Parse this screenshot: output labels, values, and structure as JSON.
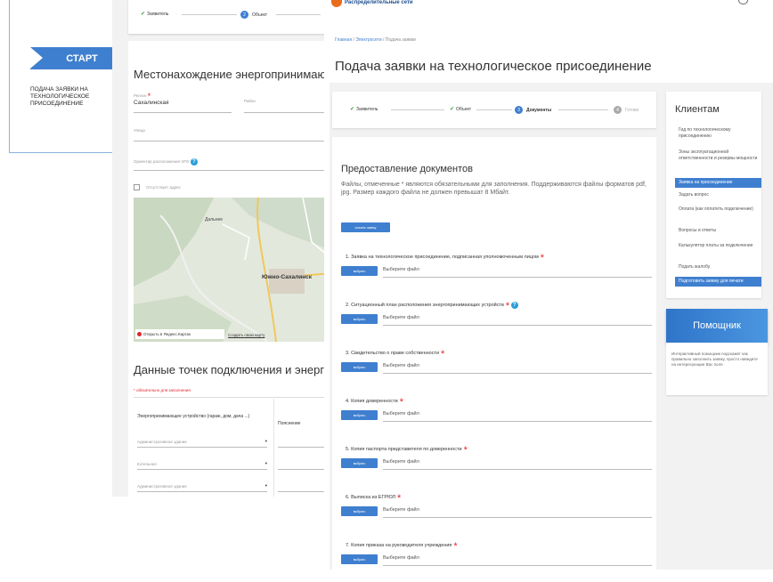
{
  "promo": {
    "start": "СТАРТ",
    "text": "ПОДАЧА ЗАЯВКИ НА ТЕХНОЛОГИЧЕСКОЕ ПРИСОЕДИНЕНИЕ"
  },
  "mid": {
    "steps": {
      "applicant": "Заявитель",
      "object_num": "2",
      "object": "Объект"
    },
    "location_title": "Местонахождение энергопринимающих",
    "region_label": "Регион",
    "region_value": "Сахалинская",
    "district_label": "Район",
    "street_label": "Улица",
    "landmark_label": "Ориентир расположения ЭПУ",
    "no_address": "Отсутствует адрес",
    "map": {
      "city": "Южно-Сахалинск",
      "place": "Дальнее",
      "open_in": "Открыть в Яндекс.Картах",
      "create_map": "Создать свою карту"
    },
    "points_title": "Данные точек подключения и энергопри",
    "required_note": "* обязательно для заполнения",
    "device_header": "Энергопринимающее устройство (гараж, дом, дача ...)",
    "explanation_header": "Пояснение",
    "rows": [
      "Административное здание",
      "Котельная",
      "Административное здание"
    ]
  },
  "header": {
    "brand": "Распределительные сети"
  },
  "breadcrumb": {
    "home": "Главная",
    "sep1": " / ",
    "elec": "Электросети",
    "sep2": " / ",
    "current": "Подача заявки"
  },
  "page_title": "Подача заявки на технологическое присоединение",
  "stepper": {
    "s1": "Заявитель",
    "s2": "Объект",
    "s3_num": "3",
    "s3": "Документы",
    "s4_num": "4",
    "s4": "Готово"
  },
  "docs": {
    "title": "Предоставление документов",
    "note": "Файлы, отмеченные * являются обязательными для заполнения. Поддерживаются файлы форматов pdf, jpg. Размер каждого файла не должен превышат 8 Мбайт.",
    "download": "скачать заявку",
    "choose_btn": "выбрать",
    "choose_file": "Выберите файл",
    "items": [
      "1. Заявка на технологическое присоединение, подписанная уполномоченным лицом",
      "2. Ситуационный план расположения энергопринимающих устройств",
      "3. Свидетельство о праве собственности",
      "4. Копия доверенности",
      "5. Копия паспорта представителя по доверенности",
      "6. Выписка из ЕГРЮЛ",
      "7. Копия приказа на руководителя учреждения"
    ]
  },
  "sidebar": {
    "title": "Клиентам",
    "items": [
      "Гид по технологическому присоединению",
      "Зоны эксплуатационной ответственности и резервы мощности",
      "Заявка на присоединение",
      "Задать вопрос",
      "Оплата (как оплатить подключение)",
      "Вопросы и ответы",
      "Калькулятор платы за подключение",
      "Подать жалобу",
      "Подготовить заявку для печати"
    ]
  },
  "assistant": {
    "title": "Помощник",
    "text": "Интерактивный помощник подскажет как правильно заполнить заявку, просто наведите на интересующие Вас поля"
  }
}
